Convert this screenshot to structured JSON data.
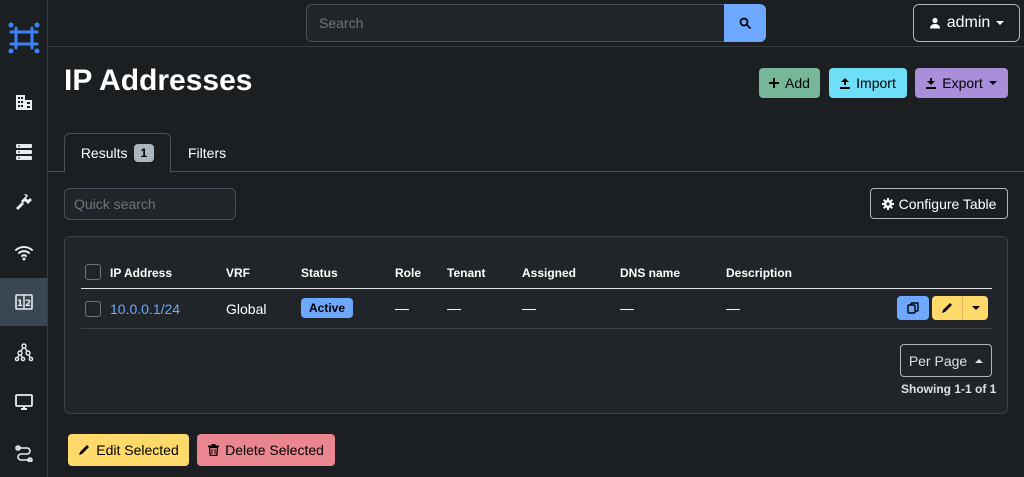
{
  "app": {
    "logo_icon": "netbox-logo-icon",
    "accent": "#6ea8fe"
  },
  "sidebar": {
    "items": [
      {
        "name": "organization",
        "icon": "building-icon",
        "active": false
      },
      {
        "name": "devices",
        "icon": "server-icon",
        "active": false
      },
      {
        "name": "connections",
        "icon": "plug-icon",
        "active": false
      },
      {
        "name": "wireless",
        "icon": "wifi-icon",
        "active": false
      },
      {
        "name": "ipam",
        "icon": "counter-icon",
        "active": true
      },
      {
        "name": "overlay",
        "icon": "graph-icon",
        "active": false
      },
      {
        "name": "virtualization",
        "icon": "monitor-icon",
        "active": false
      },
      {
        "name": "circuits",
        "icon": "circuit-icon",
        "active": false
      }
    ]
  },
  "header": {
    "search_placeholder": "Search",
    "user_label": "admin"
  },
  "page": {
    "title": "IP Addresses",
    "actions": {
      "add": "Add",
      "import": "Import",
      "export": "Export"
    }
  },
  "tabs": {
    "results_label": "Results",
    "results_count": "1",
    "filters_label": "Filters"
  },
  "toolbar": {
    "quick_search_placeholder": "Quick search",
    "configure_label": "Configure Table"
  },
  "table": {
    "columns": [
      "IP Address",
      "VRF",
      "Status",
      "Role",
      "Tenant",
      "Assigned",
      "DNS name",
      "Description"
    ],
    "rows": [
      {
        "ip_address": "10.0.0.1/24",
        "vrf": "Global",
        "status": "Active",
        "role": "—",
        "tenant": "—",
        "assigned": "—",
        "dns_name": "—",
        "description": "—"
      }
    ],
    "per_page_label": "Per Page",
    "showing": "Showing 1-1 of 1"
  },
  "bulk": {
    "edit_label": "Edit Selected",
    "delete_label": "Delete Selected"
  },
  "colors": {
    "add": "#75b798",
    "import": "#6edff6",
    "export": "#a98eda",
    "warning": "#ffda6a",
    "danger": "#ea868f",
    "primary": "#6ea8fe"
  }
}
